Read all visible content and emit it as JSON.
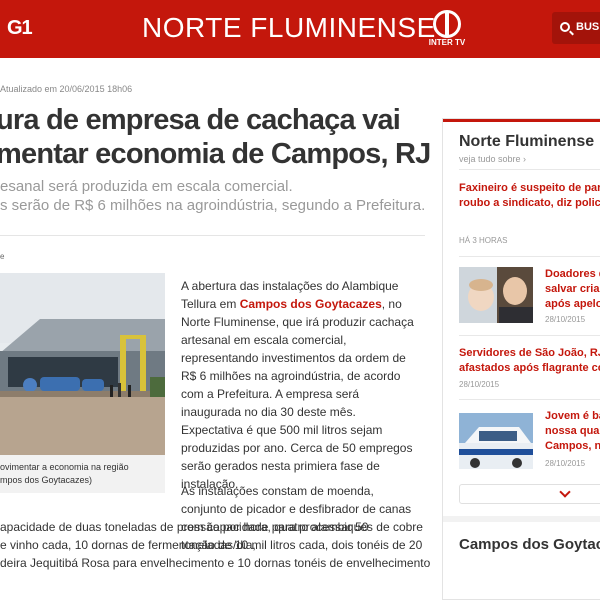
{
  "header": {
    "logo": "G1",
    "title": "NORTE FLUMINENSE",
    "intertv_label": "INTER TV",
    "search_label": "BUS"
  },
  "article": {
    "updated": "Atualizado em 20/06/2015 18h06",
    "headline_lines": [
      "ura de empresa de cachaça vai",
      "mentar economia de Campos, RJ"
    ],
    "subtitle_lines": [
      "esanal será produzida em escala comercial.",
      "s serão de R$ 6 milhões na agroindústria, segundo a Prefeitura."
    ],
    "share_fragment": "e",
    "caption_lines": [
      "ovimentar a economia na região",
      "mpos dos Goytacazes)"
    ],
    "body_p1_before_link": "A abertura das instalações do Alambique Tellura em ",
    "body_p1_link": "Campos dos Goytacazes",
    "body_p1_after_link": ", no Norte Fluminense, que irá produzir cachaça artesanal em escala comercial, representando investimentos da ordem de R$ 6 milhões na agroindústria, de acordo com a Prefeitura. A empresa será inaugurada no dia 30 deste mês. Expectativa é que 500 mil litros sejam produzidas por ano. Cerca de 50 empregos serão gerados nesta primiera fase de instalação.",
    "body_p2_first": "As instalações constam de moenda, conjunto de picador e desfibrador de canas com capacidade para processar 50 toneladas/dia,",
    "body_p2_wide_lines": [
      "apacidade de duas toneladas de pressão por hora, quatro alambiques de cobre",
      "e vinho cada, 10 dornas de fermentação de 10 mil litros cada, dois tonéis de 20",
      "deira Jequitibá Rosa para envelhecimento e 10 dornas tonéis de envelhecimento"
    ]
  },
  "sidebar": {
    "title": "Norte Fluminense",
    "see_all": "veja tudo sobre ›",
    "items": [
      {
        "title_lines": [
          "Faxineiro é suspeito de parti",
          "roubo a sindicato, diz policia"
        ],
        "time": "HÁ 3 HORAS"
      },
      {
        "title_lines": [
          "Doadores d",
          "salvar crian",
          "após apelo"
        ],
        "time": "28/10/2015",
        "thumb": "woman-and-baby-photo"
      },
      {
        "title_lines": [
          "Servidores de São João, RJ,",
          "afastados após flagrante co"
        ],
        "time": "28/10/2015"
      },
      {
        "title_lines": [
          "Jovem é ba",
          "nossa quart",
          "Campos, ne"
        ],
        "time": "28/10/2015",
        "thumb": "police-car-photo"
      }
    ],
    "bottom_title": "Campos dos Goytaca"
  },
  "colors": {
    "brand_red": "#c4170c",
    "text_dark": "#333333",
    "text_gray": "#999999"
  }
}
